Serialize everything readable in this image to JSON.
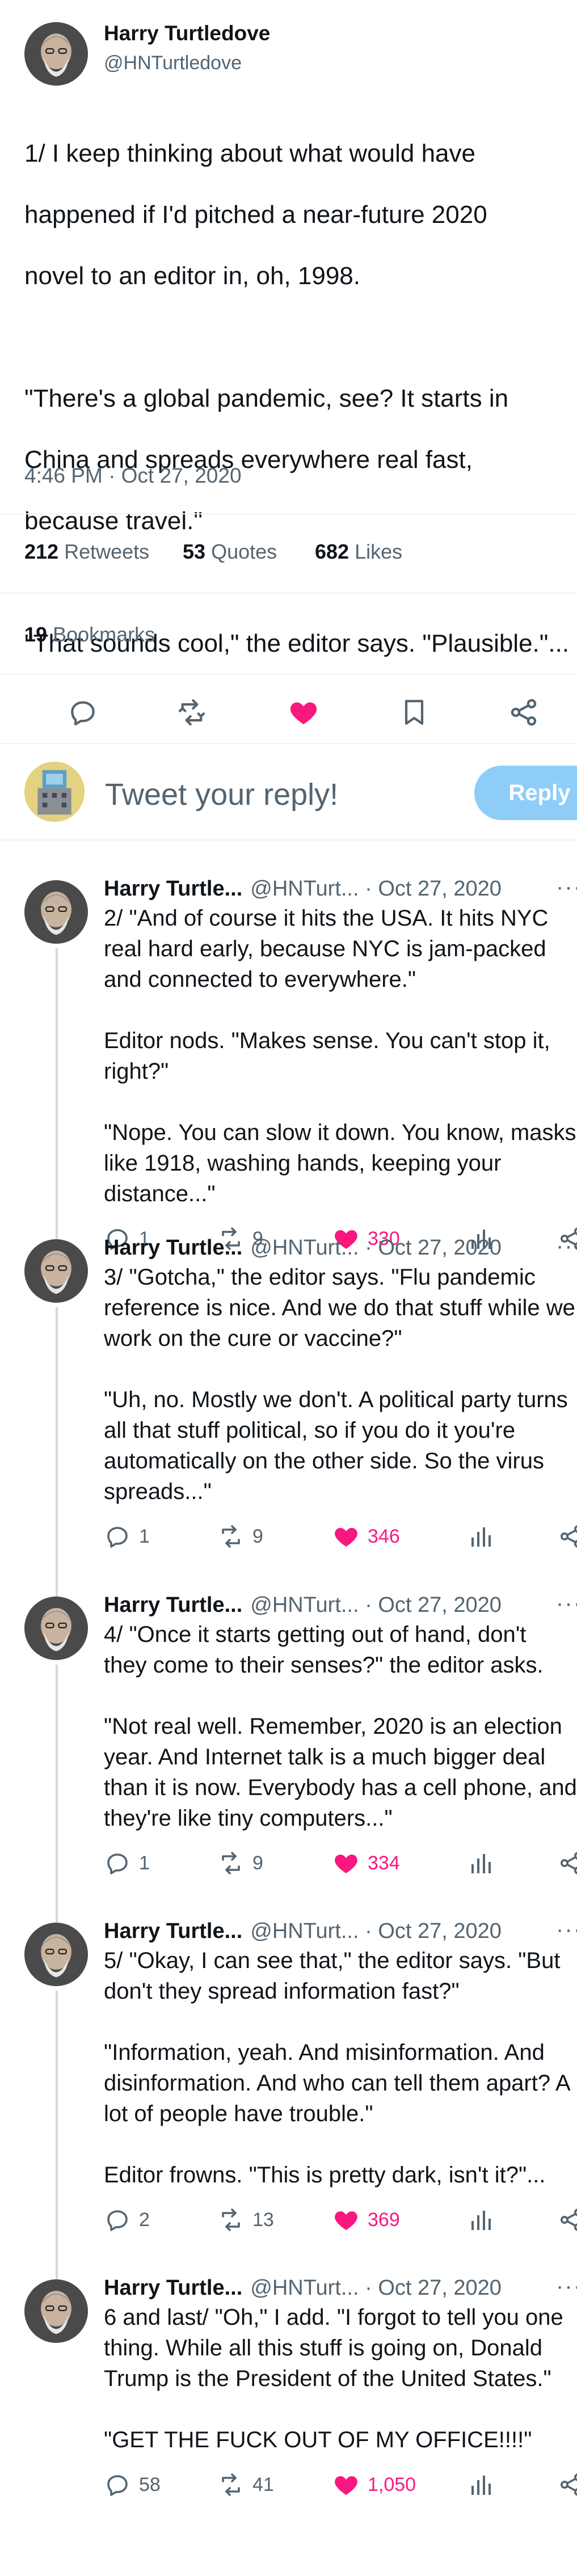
{
  "main_tweet": {
    "author_name": "Harry Turtledove",
    "author_handle": "@HNTurtledove",
    "text_lines": [
      "1/ I keep thinking about what would have",
      "happened if I'd pitched a near-future 2020",
      "novel to an editor in, oh, 1998.",
      "",
      "\"There's a global pandemic, see? It starts in",
      "China and spreads everywhere real fast,",
      "because travel.\"",
      "",
      "\"That sounds cool,\" the editor says. \"Plausible.\"..."
    ],
    "timestamp": "4:46 PM · Oct 27, 2020",
    "stats": {
      "retweets_count": "212",
      "retweets_label": "Retweets",
      "quotes_count": "53",
      "quotes_label": "Quotes",
      "likes_count": "682",
      "likes_label": "Likes",
      "bookmarks_count": "19",
      "bookmarks_label": "Bookmarks"
    },
    "actions": [
      "reply-icon",
      "retweet-icon",
      "like-icon",
      "bookmark-icon",
      "share-icon"
    ],
    "like_color": "#f91880"
  },
  "reply_box": {
    "placeholder": "Tweet your reply!",
    "button_label": "Reply",
    "button_color": "#8ecdf8"
  },
  "thread": [
    {
      "name": "Harry Turtle...",
      "handle": "@HNTurt...",
      "date": "· Oct 27, 2020",
      "more": "···",
      "paragraphs": [
        [
          "2/ \"And of course it hits the USA. It hits NYC",
          "real hard early, because NYC is jam-packed",
          "and connected to everywhere.\""
        ],
        [
          "Editor nods. \"Makes sense. You can't stop it,",
          "right?\""
        ],
        [
          "\"Nope. You can slow it down. You know, masks",
          "like 1918, washing hands, keeping your",
          "distance...\""
        ]
      ],
      "replies": "1",
      "retweets": "9",
      "likes": "330"
    },
    {
      "name": "Harry Turtle...",
      "handle": "@HNTurt...",
      "date": "· Oct 27, 2020",
      "more": "···",
      "paragraphs": [
        [
          "3/ \"Gotcha,\" the editor says. \"Flu pandemic",
          "reference is nice. And we do that stuff while we",
          "work on the cure or vaccine?\""
        ],
        [
          "\"Uh, no. Mostly we don't. A political party turns",
          "all that stuff political, so if you do it you're",
          "automatically on the other side. So the virus",
          "spreads...\""
        ]
      ],
      "replies": "1",
      "retweets": "9",
      "likes": "346"
    },
    {
      "name": "Harry Turtle...",
      "handle": "@HNTurt...",
      "date": "· Oct 27, 2020",
      "more": "···",
      "paragraphs": [
        [
          "4/ \"Once it starts getting out of hand, don't",
          "they come to their senses?\" the editor asks."
        ],
        [
          "\"Not real well. Remember, 2020 is an election",
          "year. And Internet talk is a much bigger deal",
          "than it is now. Everybody has a cell phone, and",
          "they're like tiny computers...\""
        ]
      ],
      "replies": "1",
      "retweets": "9",
      "likes": "334"
    },
    {
      "name": "Harry Turtle...",
      "handle": "@HNTurt...",
      "date": "· Oct 27, 2020",
      "more": "···",
      "paragraphs": [
        [
          "5/ \"Okay, I can see that,\" the editor says. \"But",
          "don't they spread information fast?\""
        ],
        [
          "\"Information, yeah. And misinformation. And",
          "disinformation. And who can tell them apart? A",
          "lot of people have trouble.\""
        ],
        [
          "Editor frowns. \"This is pretty dark, isn't it?\"..."
        ]
      ],
      "replies": "2",
      "retweets": "13",
      "likes": "369"
    },
    {
      "name": "Harry Turtle...",
      "handle": "@HNTurt...",
      "date": "· Oct 27, 2020",
      "more": "···",
      "paragraphs": [
        [
          "6 and last/ \"Oh,\" I add. \"I forgot to tell you one",
          "thing. While all this stuff is going on, Donald",
          "Trump is the President of the United States.\""
        ],
        [
          "\"GET THE FUCK OUT OF MY OFFICE!!!!\""
        ]
      ],
      "replies": "58",
      "retweets": "41",
      "likes": "1,050"
    }
  ]
}
